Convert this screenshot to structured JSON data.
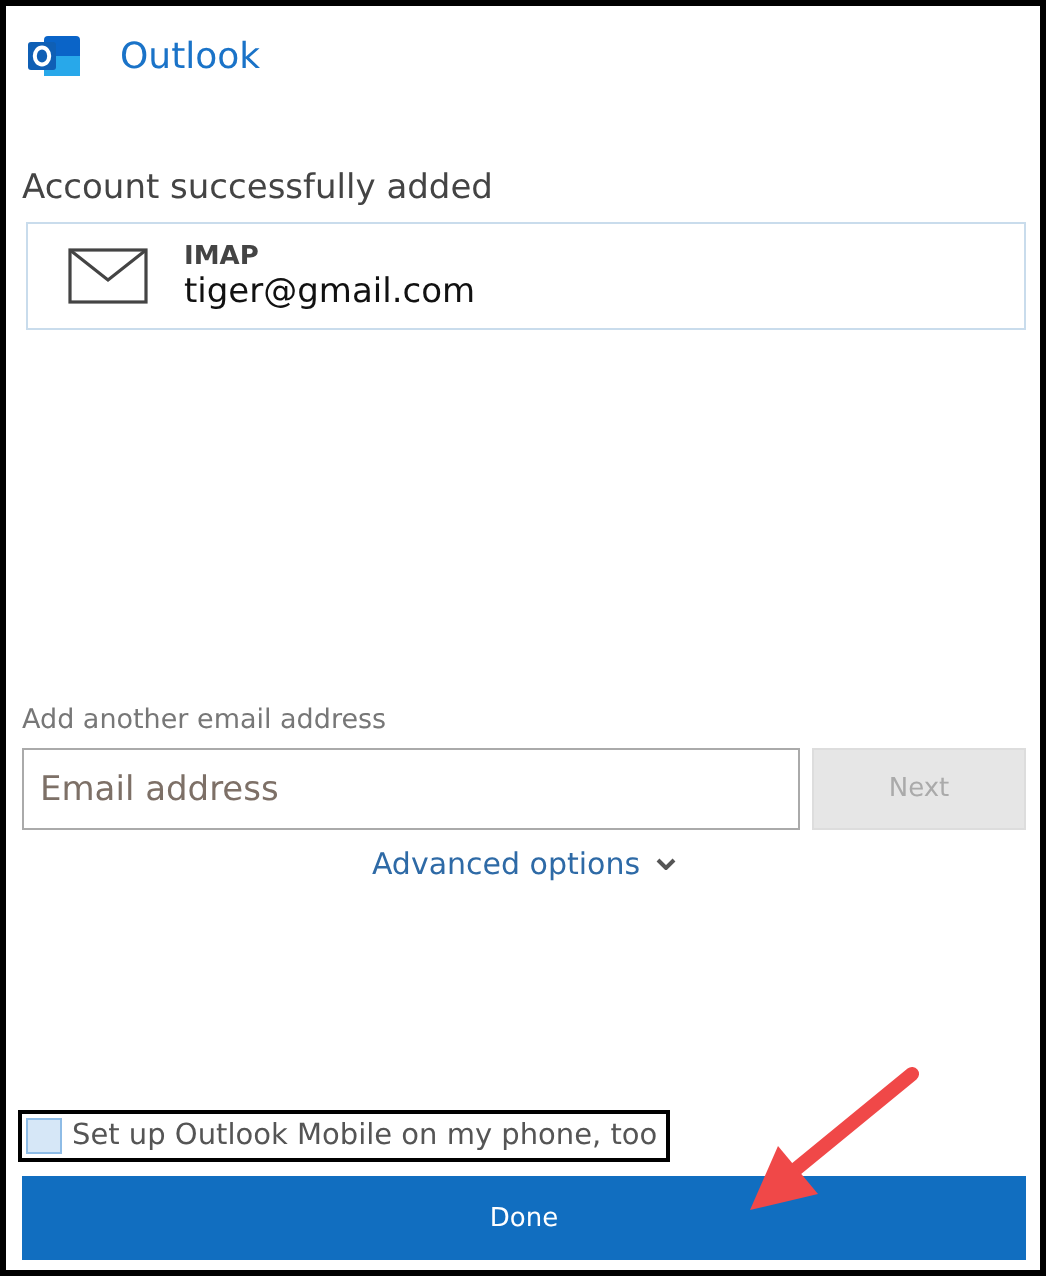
{
  "app": {
    "title": "Outlook"
  },
  "heading": "Account successfully added",
  "account": {
    "type": "IMAP",
    "email": "tiger@gmail.com"
  },
  "add_another": {
    "label": "Add another email address",
    "placeholder": "Email address",
    "next_button": {
      "label": "Next",
      "disabled": true
    }
  },
  "advanced_options": "Advanced options",
  "mobile_setup": {
    "label": "Set up Outlook Mobile on my phone, too",
    "checked": false
  },
  "done_button": "Done"
}
